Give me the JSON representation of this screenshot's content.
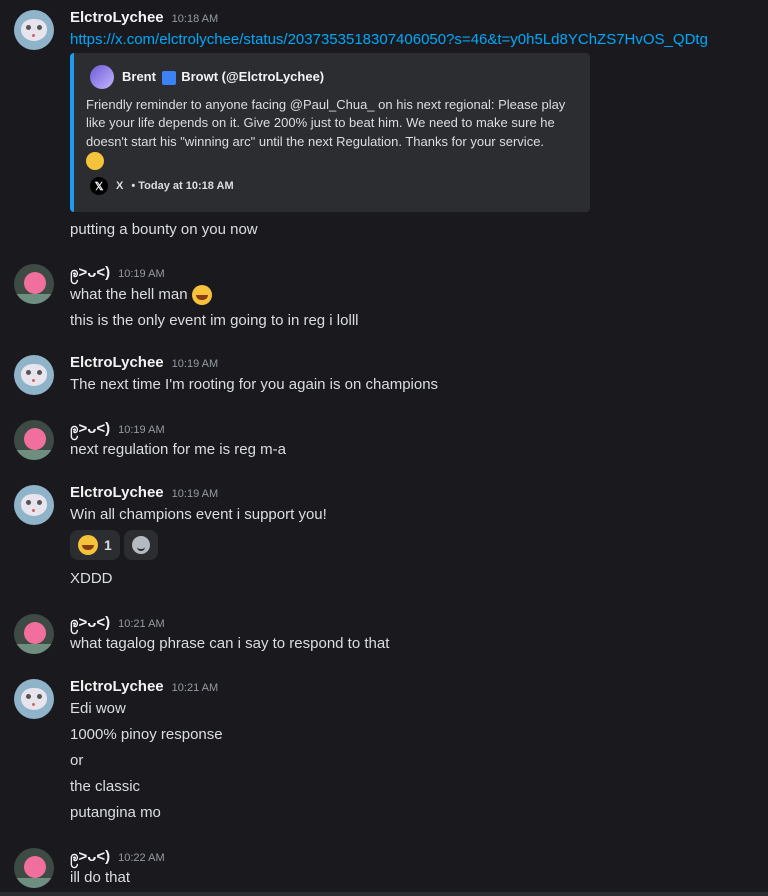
{
  "messages": {
    "m1": {
      "username": "ElctroLychee",
      "time": "10:18 AM",
      "link": "https://x.com/elctrolychee/status/2037353518307406050?s=46&t=y0h5Ld8YChZS7HvOS_QDtg",
      "embed": {
        "author_name": "Brent",
        "author_handle": "Browt (@ElctroLychee)",
        "description": "Friendly reminder to anyone facing @Paul_Chua_ on his next regional: Please play like your life depends on it. Give 200% just to beat him. We need to make sure he doesn't start his \"winning arc\" until the next Regulation. Thanks for your service.",
        "footer_x": "X",
        "footer_time": "• Today at 10:18 AM"
      },
      "followup": "putting a bounty on you now"
    },
    "m2": {
      "username": "ဨ˃ᴗ˂)",
      "time": "10:19 AM",
      "line1": "what the hell man",
      "line2": "this is the only event im going to in reg i lolll"
    },
    "m3": {
      "username": "ElctroLychee",
      "time": "10:19 AM",
      "line1": "The next time I'm rooting for you again is on champions"
    },
    "m4": {
      "username": "ဨ˃ᴗ˂)",
      "time": "10:19 AM",
      "line1": "next regulation for me is reg m-a"
    },
    "m5": {
      "username": "ElctroLychee",
      "time": "10:19 AM",
      "line1": "Win all champions event i support you!",
      "reaction_count": "1",
      "followup": "XDDD"
    },
    "m6": {
      "username": "ဨ˃ᴗ˂)",
      "time": "10:21 AM",
      "line1": "what tagalog phrase can i say to respond to that"
    },
    "m7": {
      "username": "ElctroLychee",
      "time": "10:21 AM",
      "lines": [
        "Edi wow",
        "1000% pinoy response",
        "or",
        "the classic",
        "putangina mo"
      ]
    },
    "m8": {
      "username": "ဨ˃ᴗ˂)",
      "time": "10:22 AM",
      "line1": "ill do that"
    }
  },
  "icons": {
    "laugh": "rolling-on-floor-laughing-emoji",
    "add_reaction": "add-reaction-icon",
    "x_logo": "x-logo"
  },
  "colors": {
    "background": "#1a1a1e",
    "link": "#00a8fc",
    "embed_border": "#1d9bf0"
  }
}
